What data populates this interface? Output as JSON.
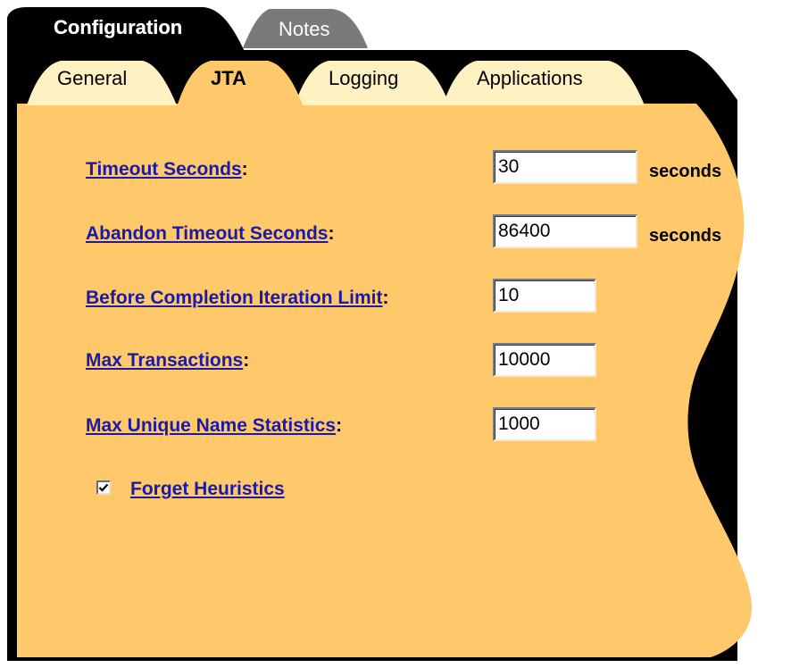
{
  "colors": {
    "panel": "#ffc96b",
    "frame": "#000000",
    "active_top_tab": "#000000",
    "inactive_top_tab": "#7a7a7a",
    "sub_tab": "#fff2c2",
    "link": "#1a1aa8"
  },
  "top_tabs": [
    {
      "label": "Configuration",
      "active": true
    },
    {
      "label": "Notes",
      "active": false
    }
  ],
  "sub_tabs": [
    {
      "label": "General",
      "active": false
    },
    {
      "label": "JTA",
      "active": true
    },
    {
      "label": "Logging",
      "active": false
    },
    {
      "label": "Applications",
      "active": false
    }
  ],
  "fields": [
    {
      "label": "Timeout Seconds",
      "suffix": ":",
      "value": "30",
      "unit": "seconds"
    },
    {
      "label": "Abandon Timeout Seconds",
      "suffix": ":",
      "value": "86400",
      "unit": "seconds"
    },
    {
      "label": "Before Completion Iteration Limit",
      "suffix": ":",
      "value": "10",
      "unit": ""
    },
    {
      "label": "Max Transactions",
      "suffix": ":",
      "value": "10000",
      "unit": ""
    },
    {
      "label": "Max Unique Name Statistics",
      "suffix": ":",
      "value": "1000",
      "unit": ""
    }
  ],
  "checkbox": {
    "label": "Forget Heuristics",
    "checked": true
  }
}
